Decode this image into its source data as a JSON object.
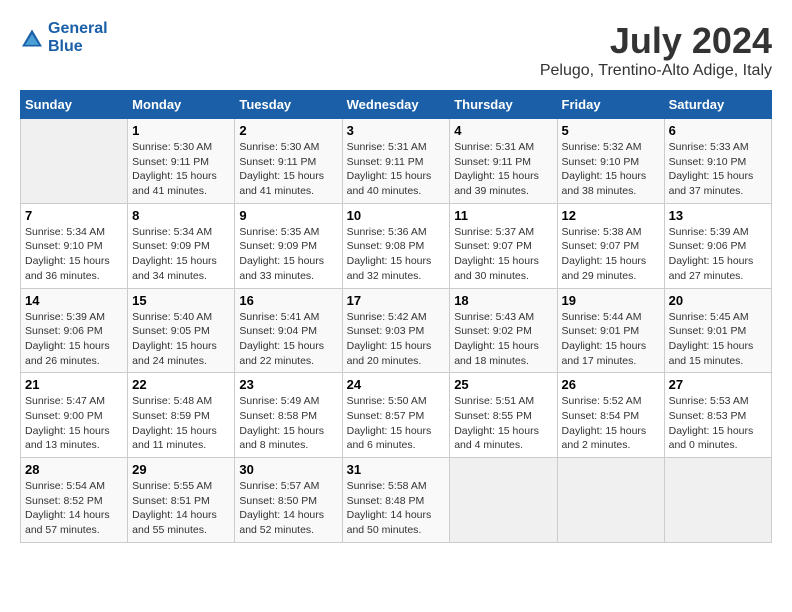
{
  "logo": {
    "line1": "General",
    "line2": "Blue"
  },
  "title": "July 2024",
  "location": "Pelugo, Trentino-Alto Adige, Italy",
  "days_header": [
    "Sunday",
    "Monday",
    "Tuesday",
    "Wednesday",
    "Thursday",
    "Friday",
    "Saturday"
  ],
  "weeks": [
    [
      {
        "day": "",
        "info": ""
      },
      {
        "day": "1",
        "info": "Sunrise: 5:30 AM\nSunset: 9:11 PM\nDaylight: 15 hours\nand 41 minutes."
      },
      {
        "day": "2",
        "info": "Sunrise: 5:30 AM\nSunset: 9:11 PM\nDaylight: 15 hours\nand 41 minutes."
      },
      {
        "day": "3",
        "info": "Sunrise: 5:31 AM\nSunset: 9:11 PM\nDaylight: 15 hours\nand 40 minutes."
      },
      {
        "day": "4",
        "info": "Sunrise: 5:31 AM\nSunset: 9:11 PM\nDaylight: 15 hours\nand 39 minutes."
      },
      {
        "day": "5",
        "info": "Sunrise: 5:32 AM\nSunset: 9:10 PM\nDaylight: 15 hours\nand 38 minutes."
      },
      {
        "day": "6",
        "info": "Sunrise: 5:33 AM\nSunset: 9:10 PM\nDaylight: 15 hours\nand 37 minutes."
      }
    ],
    [
      {
        "day": "7",
        "info": "Sunrise: 5:34 AM\nSunset: 9:10 PM\nDaylight: 15 hours\nand 36 minutes."
      },
      {
        "day": "8",
        "info": "Sunrise: 5:34 AM\nSunset: 9:09 PM\nDaylight: 15 hours\nand 34 minutes."
      },
      {
        "day": "9",
        "info": "Sunrise: 5:35 AM\nSunset: 9:09 PM\nDaylight: 15 hours\nand 33 minutes."
      },
      {
        "day": "10",
        "info": "Sunrise: 5:36 AM\nSunset: 9:08 PM\nDaylight: 15 hours\nand 32 minutes."
      },
      {
        "day": "11",
        "info": "Sunrise: 5:37 AM\nSunset: 9:07 PM\nDaylight: 15 hours\nand 30 minutes."
      },
      {
        "day": "12",
        "info": "Sunrise: 5:38 AM\nSunset: 9:07 PM\nDaylight: 15 hours\nand 29 minutes."
      },
      {
        "day": "13",
        "info": "Sunrise: 5:39 AM\nSunset: 9:06 PM\nDaylight: 15 hours\nand 27 minutes."
      }
    ],
    [
      {
        "day": "14",
        "info": "Sunrise: 5:39 AM\nSunset: 9:06 PM\nDaylight: 15 hours\nand 26 minutes."
      },
      {
        "day": "15",
        "info": "Sunrise: 5:40 AM\nSunset: 9:05 PM\nDaylight: 15 hours\nand 24 minutes."
      },
      {
        "day": "16",
        "info": "Sunrise: 5:41 AM\nSunset: 9:04 PM\nDaylight: 15 hours\nand 22 minutes."
      },
      {
        "day": "17",
        "info": "Sunrise: 5:42 AM\nSunset: 9:03 PM\nDaylight: 15 hours\nand 20 minutes."
      },
      {
        "day": "18",
        "info": "Sunrise: 5:43 AM\nSunset: 9:02 PM\nDaylight: 15 hours\nand 18 minutes."
      },
      {
        "day": "19",
        "info": "Sunrise: 5:44 AM\nSunset: 9:01 PM\nDaylight: 15 hours\nand 17 minutes."
      },
      {
        "day": "20",
        "info": "Sunrise: 5:45 AM\nSunset: 9:01 PM\nDaylight: 15 hours\nand 15 minutes."
      }
    ],
    [
      {
        "day": "21",
        "info": "Sunrise: 5:47 AM\nSunset: 9:00 PM\nDaylight: 15 hours\nand 13 minutes."
      },
      {
        "day": "22",
        "info": "Sunrise: 5:48 AM\nSunset: 8:59 PM\nDaylight: 15 hours\nand 11 minutes."
      },
      {
        "day": "23",
        "info": "Sunrise: 5:49 AM\nSunset: 8:58 PM\nDaylight: 15 hours\nand 8 minutes."
      },
      {
        "day": "24",
        "info": "Sunrise: 5:50 AM\nSunset: 8:57 PM\nDaylight: 15 hours\nand 6 minutes."
      },
      {
        "day": "25",
        "info": "Sunrise: 5:51 AM\nSunset: 8:55 PM\nDaylight: 15 hours\nand 4 minutes."
      },
      {
        "day": "26",
        "info": "Sunrise: 5:52 AM\nSunset: 8:54 PM\nDaylight: 15 hours\nand 2 minutes."
      },
      {
        "day": "27",
        "info": "Sunrise: 5:53 AM\nSunset: 8:53 PM\nDaylight: 15 hours\nand 0 minutes."
      }
    ],
    [
      {
        "day": "28",
        "info": "Sunrise: 5:54 AM\nSunset: 8:52 PM\nDaylight: 14 hours\nand 57 minutes."
      },
      {
        "day": "29",
        "info": "Sunrise: 5:55 AM\nSunset: 8:51 PM\nDaylight: 14 hours\nand 55 minutes."
      },
      {
        "day": "30",
        "info": "Sunrise: 5:57 AM\nSunset: 8:50 PM\nDaylight: 14 hours\nand 52 minutes."
      },
      {
        "day": "31",
        "info": "Sunrise: 5:58 AM\nSunset: 8:48 PM\nDaylight: 14 hours\nand 50 minutes."
      },
      {
        "day": "",
        "info": ""
      },
      {
        "day": "",
        "info": ""
      },
      {
        "day": "",
        "info": ""
      }
    ]
  ]
}
